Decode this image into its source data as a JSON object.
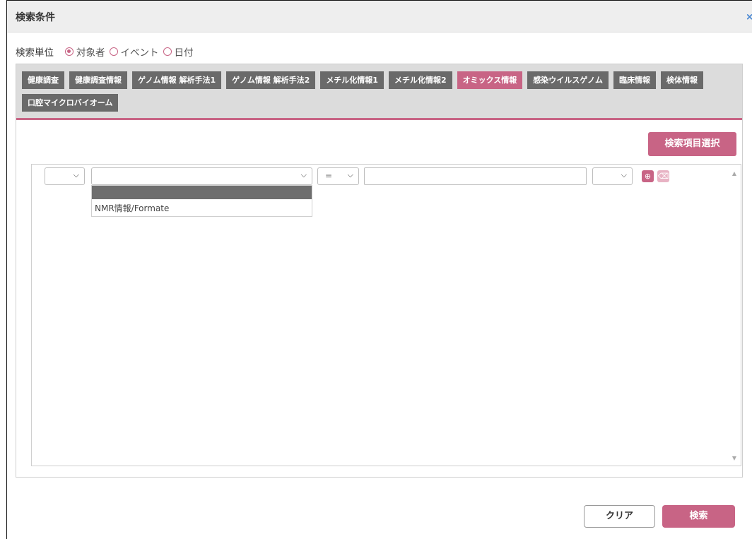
{
  "dialog": {
    "title": "検索条件",
    "close": "×"
  },
  "search_unit": {
    "label": "検索単位",
    "options": [
      {
        "label": "対象者",
        "selected": true
      },
      {
        "label": "イベント",
        "selected": false
      },
      {
        "label": "日付",
        "selected": false
      }
    ]
  },
  "tabs": [
    {
      "label": "健康調査",
      "active": false
    },
    {
      "label": "健康調査情報",
      "active": false
    },
    {
      "label": "ゲノム情報 解析手法1",
      "active": false
    },
    {
      "label": "ゲノム情報 解析手法2",
      "active": false
    },
    {
      "label": "メチル化情報1",
      "active": false
    },
    {
      "label": "メチル化情報2",
      "active": false
    },
    {
      "label": "オミックス情報",
      "active": true
    },
    {
      "label": "感染ウイルスゲノム",
      "active": false
    },
    {
      "label": "臨床情報",
      "active": false
    },
    {
      "label": "検体情報",
      "active": false
    },
    {
      "label": "口腔マイクロバイオーム",
      "active": false
    }
  ],
  "select_items_button": "検索項目選択",
  "condition_row": {
    "operator": "=",
    "field_options": [
      "",
      "NMR情報/Formate"
    ]
  },
  "icons": {
    "add": "add-circle-icon",
    "delete": "trash-icon",
    "chevron": "chevron-down-icon"
  },
  "colors": {
    "accent": "#c86485",
    "tab": "#6a6a6a"
  },
  "buttons": {
    "clear": "クリア",
    "search": "検索"
  }
}
